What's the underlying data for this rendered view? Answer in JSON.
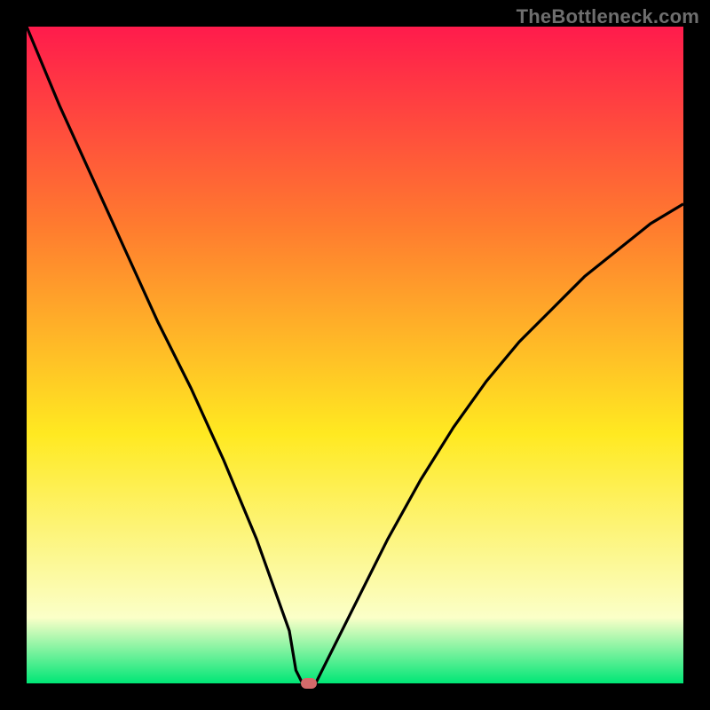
{
  "watermark_text": "TheBottleneck.com",
  "colors": {
    "bg_black": "#000000",
    "grad_top": "#ff1b4c",
    "grad_mid1": "#ff7a2f",
    "grad_mid2": "#ffe921",
    "grad_paleyellow": "#fbffc8",
    "grad_green": "#00e676",
    "curve": "#000000",
    "dot": "#d46a6a",
    "watermark": "#6e6e6e"
  },
  "chart_data": {
    "type": "line",
    "title": "",
    "xlabel": "",
    "ylabel": "",
    "xlim": [
      0,
      100
    ],
    "ylim": [
      0,
      100
    ],
    "x": [
      0,
      5,
      10,
      15,
      20,
      25,
      30,
      35,
      40,
      41,
      42,
      44,
      45,
      50,
      55,
      60,
      65,
      70,
      75,
      80,
      85,
      90,
      95,
      100
    ],
    "values": [
      100,
      88,
      77,
      66,
      55,
      45,
      34,
      22,
      8,
      2,
      0,
      0,
      2,
      12,
      22,
      31,
      39,
      46,
      52,
      57,
      62,
      66,
      70,
      73
    ],
    "min_point": {
      "x": 43,
      "y": 0
    },
    "grid": false,
    "legend": false
  }
}
